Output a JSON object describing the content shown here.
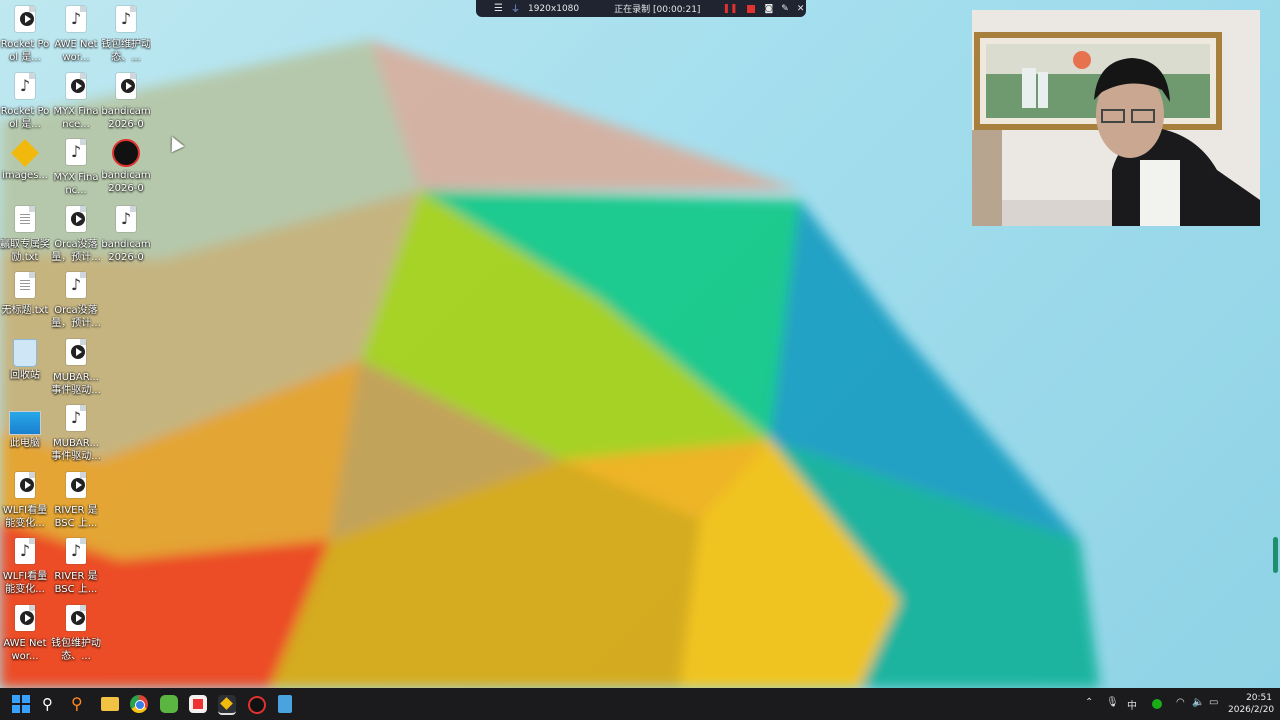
{
  "recorder": {
    "resolution": "1920x1080",
    "status": "正在录制 [00:00:21]"
  },
  "desktop_icons": [
    {
      "label": "Rocket Pool 是...",
      "icon": "video-file-icon"
    },
    {
      "label": "AWE Networ...",
      "icon": "audio-file-icon"
    },
    {
      "label": "钱包维护动态、...",
      "icon": "audio-file-icon"
    },
    {
      "label": "Rocket Pool 是...",
      "icon": "audio-file-icon"
    },
    {
      "label": "MYX Finance...",
      "icon": "video-file-icon"
    },
    {
      "label": "bandicam 2026-02...",
      "icon": "video-file-icon"
    },
    {
      "label": "images...",
      "icon": "binance-icon"
    },
    {
      "label": "MYX Financ...",
      "icon": "audio-file-icon"
    },
    {
      "label": "bandicam 2026-02...",
      "icon": "bandicam-icon"
    },
    {
      "label": "赢取专属奖励.txt",
      "icon": "text-file-icon"
    },
    {
      "label": "Orca没落量，预计...",
      "icon": "video-file-icon"
    },
    {
      "label": "bandicam 2026-02...",
      "icon": "audio-file-icon"
    },
    {
      "label": "无标题.txt",
      "icon": "text-file-icon"
    },
    {
      "label": "Orca没落量，预计...",
      "icon": "audio-file-icon"
    },
    {
      "label": "回收站",
      "icon": "recycle-bin-icon"
    },
    {
      "label": "MUBAR... 事件驱动...",
      "icon": "video-file-icon"
    },
    {
      "label": "此电脑",
      "icon": "this-pc-icon"
    },
    {
      "label": "MUBAR... 事件驱动...",
      "icon": "audio-file-icon"
    },
    {
      "label": "WLFI看量能变化...",
      "icon": "video-file-icon"
    },
    {
      "label": "RIVER 是 BSC 上...",
      "icon": "video-file-icon"
    },
    {
      "label": "WLFI看量能变化...",
      "icon": "audio-file-icon"
    },
    {
      "label": "RIVER 是 BSC 上...",
      "icon": "audio-file-icon"
    },
    {
      "label": "AWE Networ...",
      "icon": "video-file-icon"
    },
    {
      "label": "钱包维护动态、...",
      "icon": "video-file-icon"
    }
  ],
  "taskbar": {
    "apps": [
      "start-icon",
      "search-icon",
      "search-app-icon",
      "file-explorer-icon",
      "chrome-icon",
      "wechat-icon",
      "app-icon",
      "binance-icon",
      "bandicam-icon",
      "notepad-icon"
    ],
    "tray": {
      "ime": "中",
      "time": "20:51",
      "date": "2026/2/20"
    }
  },
  "colors": {
    "taskbar": "#1b1b1d",
    "recording_red": "#e0322f",
    "desktop_sky": "#a6dfee"
  }
}
